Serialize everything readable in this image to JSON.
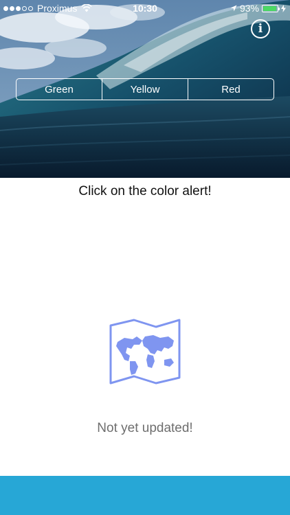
{
  "status_bar": {
    "carrier": "Proximus",
    "time": "10:30",
    "battery": "93%",
    "battery_level": 0.93
  },
  "info_button": {
    "glyph": "i"
  },
  "segments": [
    {
      "label": "Green"
    },
    {
      "label": "Yellow"
    },
    {
      "label": "Red"
    }
  ],
  "prompt_text": "Click on the color alert!",
  "update_status": "Not yet updated!",
  "colors": {
    "accent_bar": "#27a7d6",
    "map_icon": "#7f95f0"
  },
  "icons": {
    "info": "info-icon",
    "map": "world-map-icon",
    "wifi": "wifi-icon",
    "battery": "battery-icon",
    "location": "location-arrow-icon"
  }
}
